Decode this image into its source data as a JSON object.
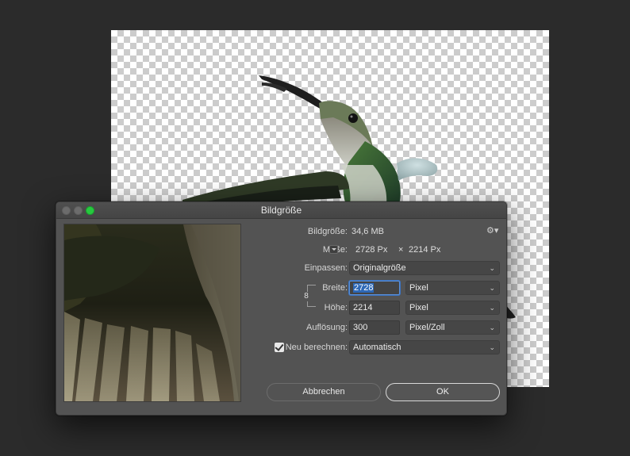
{
  "dialog": {
    "title": "Bildgröße",
    "image_size_label": "Bildgröße:",
    "image_size_value": "34,6 MB",
    "dimensions_label": "Maße:",
    "dimensions_width": "2728 Px",
    "dimensions_times": "×",
    "dimensions_height": "2214 Px",
    "fit_to_label": "Einpassen:",
    "fit_to_value": "Originalgröße",
    "width_label": "Breite:",
    "width_value": "2728",
    "width_unit": "Pixel",
    "height_label": "Höhe:",
    "height_value": "2214",
    "height_unit": "Pixel",
    "resolution_label": "Auflösung:",
    "resolution_value": "300",
    "resolution_unit": "Pixel/Zoll",
    "resample_label": "Neu berechnen:",
    "resample_checked": true,
    "resample_value": "Automatisch",
    "cancel_label": "Abbrechen",
    "ok_label": "OK"
  },
  "icons": {
    "gear": "gear-icon",
    "link": "chain-link-icon",
    "dropdown": "chevron-updown-icon"
  },
  "colors": {
    "dialog_bg": "#535353",
    "app_bg": "#2b2b2b",
    "zoom_button": "#27c93f",
    "selection": "#2d68b7"
  }
}
